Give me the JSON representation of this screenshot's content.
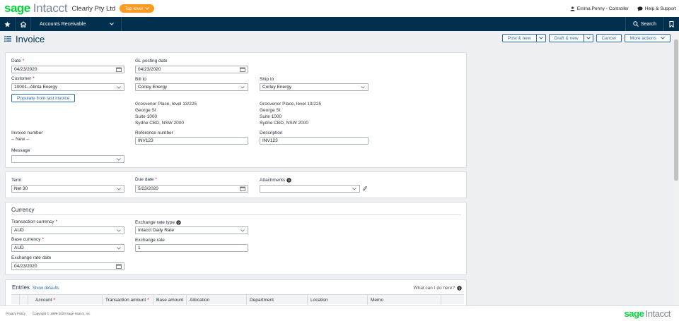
{
  "header": {
    "logo": "sage",
    "product": "Intacct",
    "company": "Clearly Pty Ltd",
    "level": "Top level",
    "user": "Emma Penny - Controller",
    "help": "Help & Support"
  },
  "nav": {
    "module": "Accounts Receivable",
    "search": "Search"
  },
  "page": {
    "title": "Invoice",
    "actions": {
      "post_new": "Post & new",
      "draft_new": "Draft & new",
      "cancel": "Cancel",
      "more": "More actions"
    }
  },
  "details": {
    "date_label": "Date",
    "date_value": "04/23/2020",
    "gl_label": "GL posting date",
    "gl_value": "04/23/2020",
    "customer_label": "Customer",
    "customer_value": "10001--Alinta Energy",
    "bill_to_label": "Bill to",
    "bill_to_value": "Corley Energy",
    "ship_to_label": "Ship to",
    "ship_to_value": "Corley Energy",
    "populate_label": "Populate from last invoice",
    "bill_address": [
      "Grosvenor Place, level 13/225",
      "George St",
      "Suite 1000",
      "Sydne CBD, NSW 2000"
    ],
    "ship_address": [
      "Grosvenor Place, level 13/225",
      "George St",
      "Suite 1000",
      "Sydne CBD, NSW 2000"
    ],
    "invoice_number_label": "Invoice number",
    "invoice_number_value": "-- New --",
    "reference_label": "Reference number",
    "reference_value": "INV123",
    "description_label": "Description",
    "description_value": "INV123",
    "message_label": "Message",
    "message_value": ""
  },
  "terms": {
    "term_label": "Term",
    "term_value": "Net 30",
    "due_label": "Due date",
    "due_value": "5/23/2020",
    "attachments_label": "Attachments",
    "attachments_value": ""
  },
  "currency": {
    "section_title": "Currency",
    "txn_currency_label": "Transaction currency",
    "txn_currency_value": "AUD",
    "rate_type_label": "Exchange rate type",
    "rate_type_value": "Intacct Daily Rate",
    "base_currency_label": "Base currency",
    "base_currency_value": "AUD",
    "rate_label": "Exchange rate",
    "rate_value": "1",
    "rate_date_label": "Exchange rate date",
    "rate_date_value": "04/23/2020"
  },
  "entries": {
    "title": "Entries",
    "show_defaults": "Show defaults",
    "help": "What can I do here?",
    "columns": [
      "Account",
      "Transaction amount",
      "Base amount",
      "Allocation",
      "Department",
      "Location",
      "Memo"
    ]
  },
  "footer": {
    "privacy": "Privacy Policy",
    "copyright": "Copyright © 1999-2020 Sage Intacct, Inc.",
    "logo": "sage",
    "product": "Intacct"
  },
  "colors": {
    "brand_green": "#00d639",
    "nav_blue": "#00304d",
    "accent_orange": "#ff9a1f",
    "link_blue": "#2d6aa3"
  }
}
